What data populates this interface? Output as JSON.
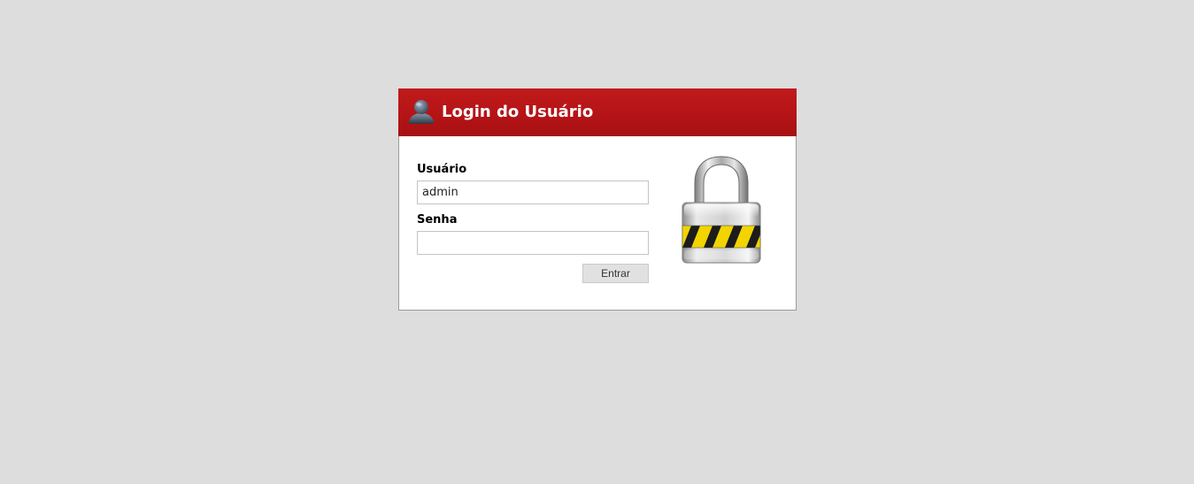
{
  "login_box": {
    "title": "Login do Usuário",
    "user_icon": "user-icon",
    "lock_icon": "padlock-icon"
  },
  "form": {
    "username_label": "Usuário",
    "username_value": "admin",
    "password_label": "Senha",
    "password_value": "",
    "submit_label": "Entrar"
  },
  "colors": {
    "header": "#b51416",
    "page_background": "#dddddd",
    "lock_stripe_yellow": "#f2d400"
  }
}
